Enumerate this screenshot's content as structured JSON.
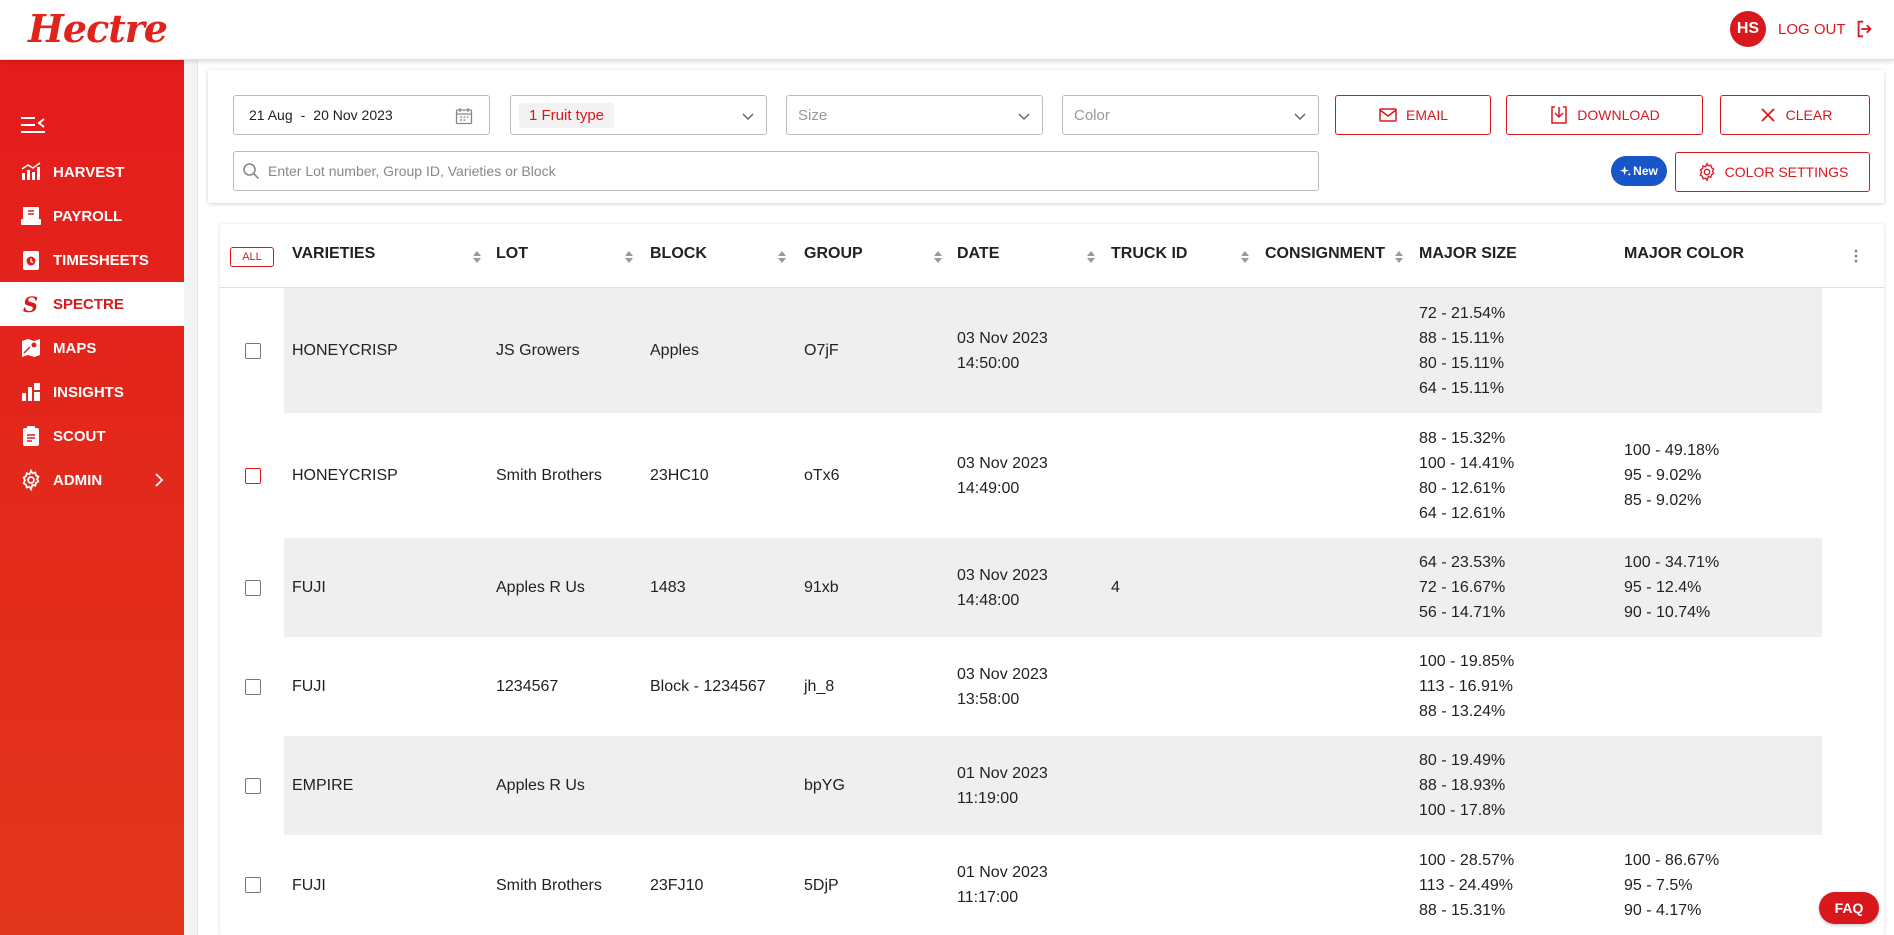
{
  "app": {
    "logo": "Hectre",
    "brand_color": "#d9181e"
  },
  "header": {
    "avatar_initials": "HS",
    "logout_label": "LOG OUT"
  },
  "sidebar": {
    "items": [
      {
        "label": "HARVEST",
        "icon": "harvest-icon"
      },
      {
        "label": "PAYROLL",
        "icon": "payroll-icon"
      },
      {
        "label": "TIMESHEETS",
        "icon": "timesheets-icon"
      },
      {
        "label": "SPECTRE",
        "icon": "spectre-icon",
        "active": true
      },
      {
        "label": "MAPS",
        "icon": "maps-icon"
      },
      {
        "label": "INSIGHTS",
        "icon": "insights-icon"
      },
      {
        "label": "SCOUT",
        "icon": "scout-icon"
      },
      {
        "label": "ADMIN",
        "icon": "gear-icon"
      }
    ]
  },
  "filters": {
    "date_from": "21 Aug",
    "date_sep": "-",
    "date_to": "20 Nov 2023",
    "fruit_type_chip": "1 Fruit type",
    "size_placeholder": "Size",
    "color_placeholder": "Color",
    "email_label": "EMAIL",
    "download_label": "DOWNLOAD",
    "clear_label": "CLEAR",
    "search_placeholder": "Enter Lot number, Group ID, Varieties or Block",
    "new_badge": "New",
    "color_settings_label": "COLOR SETTINGS"
  },
  "table": {
    "all_label": "ALL",
    "columns": [
      "VARIETIES",
      "LOT",
      "BLOCK",
      "GROUP",
      "DATE",
      "TRUCK ID",
      "CONSIGNMENT",
      "MAJOR SIZE",
      "MAJOR COLOR"
    ],
    "rows": [
      {
        "variety": "HONEYCRISP",
        "lot": "JS Growers",
        "block": "Apples",
        "group": "O7jF",
        "date": "03 Nov 2023",
        "time": "14:50:00",
        "truck": "",
        "consignment": "",
        "sizes": [
          "72 - 21.54%",
          "88 - 15.11%",
          "80 - 15.11%",
          "64 - 15.11%"
        ],
        "colors": []
      },
      {
        "variety": "HONEYCRISP",
        "lot": "Smith Brothers",
        "block": "23HC10",
        "group": "oTx6",
        "date": "03 Nov 2023",
        "time": "14:49:00",
        "truck": "",
        "consignment": "",
        "sizes": [
          "88 - 15.32%",
          "100 - 14.41%",
          "80 - 12.61%",
          "64 - 12.61%"
        ],
        "colors": [
          "100 - 49.18%",
          "95 - 9.02%",
          "85 - 9.02%"
        ]
      },
      {
        "variety": "FUJI",
        "lot": "Apples R Us",
        "block": "1483",
        "group": "91xb",
        "date": "03 Nov 2023",
        "time": "14:48:00",
        "truck": "4",
        "consignment": "",
        "sizes": [
          "64 - 23.53%",
          "72 - 16.67%",
          "56 - 14.71%"
        ],
        "colors": [
          "100 - 34.71%",
          "95 - 12.4%",
          "90 - 10.74%"
        ]
      },
      {
        "variety": "FUJI",
        "lot": "1234567",
        "block": "Block - 1234567",
        "group": "jh_8",
        "date": "03 Nov 2023",
        "time": "13:58:00",
        "truck": "",
        "consignment": "",
        "sizes": [
          "100 - 19.85%",
          "113 - 16.91%",
          "88 - 13.24%"
        ],
        "colors": []
      },
      {
        "variety": "EMPIRE",
        "lot": "Apples R Us",
        "block": "",
        "group": "bpYG",
        "date": "01 Nov 2023",
        "time": "11:19:00",
        "truck": "",
        "consignment": "",
        "sizes": [
          "80 - 19.49%",
          "88 - 18.93%",
          "100 - 17.8%"
        ],
        "colors": []
      },
      {
        "variety": "FUJI",
        "lot": "Smith Brothers",
        "block": "23FJ10",
        "group": "5DjP",
        "date": "01 Nov 2023",
        "time": "11:17:00",
        "truck": "",
        "consignment": "",
        "sizes": [
          "100 - 28.57%",
          "113 - 24.49%",
          "88 - 15.31%"
        ],
        "colors": [
          "100 - 86.67%",
          "95 - 7.5%",
          "90 - 4.17%"
        ]
      }
    ]
  },
  "faq_label": "FAQ"
}
